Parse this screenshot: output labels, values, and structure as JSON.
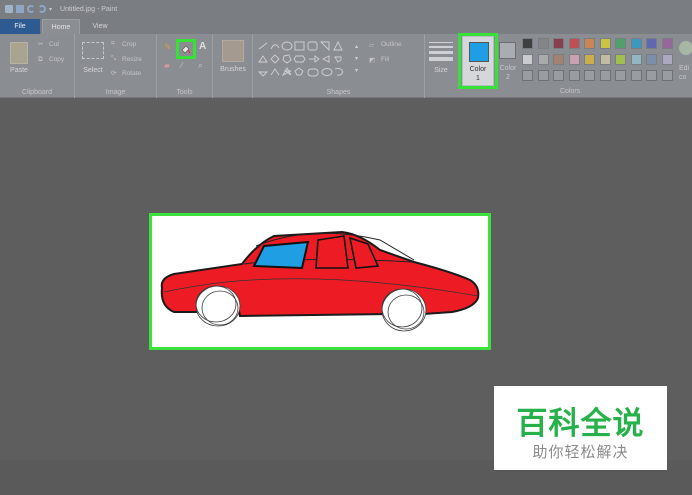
{
  "window": {
    "title": "Untitled.jpg - Paint"
  },
  "tabs": [
    {
      "label": "File"
    },
    {
      "label": "Home"
    },
    {
      "label": "View"
    }
  ],
  "clipboard": {
    "paste": "Paste",
    "cut": "Cut",
    "copy": "Copy",
    "group": "Clipboard"
  },
  "image": {
    "select": "Select",
    "crop": "Crop",
    "resize": "Resize",
    "rotate": "Rotate",
    "group": "Image"
  },
  "tools": {
    "group": "Tools"
  },
  "brushes": {
    "label": "Brushes"
  },
  "shapes": {
    "outline": "Outline",
    "fill": "Fill",
    "group": "Shapes"
  },
  "size": {
    "label": "Size"
  },
  "colors": {
    "color1_label": "Color",
    "color1_num": "1",
    "color2_label": "Color",
    "color2_num": "2",
    "edit_label": "Edi",
    "edit_label2": "co",
    "group": "Colors",
    "color1": "#1f9ee3",
    "color2": "#ffffff",
    "palette_row1": [
      "#000000",
      "#7f7f7f",
      "#880015",
      "#ed1c24",
      "#ff7f27",
      "#fff200",
      "#22b14c",
      "#00a2e8",
      "#3f48cc",
      "#a349a4"
    ],
    "palette_row2": [
      "#ffffff",
      "#c3c3c3",
      "#b97a57",
      "#ffaec9",
      "#ffc90e",
      "#efe4b0",
      "#b5e61d",
      "#99d9ea",
      "#7092be",
      "#c8bfe7"
    ]
  },
  "drawing": {
    "body_color": "#ed1c24",
    "window_color": "#1f9ee3"
  },
  "watermark": {
    "title": "百科全说",
    "subtitle": "助你轻松解决"
  }
}
